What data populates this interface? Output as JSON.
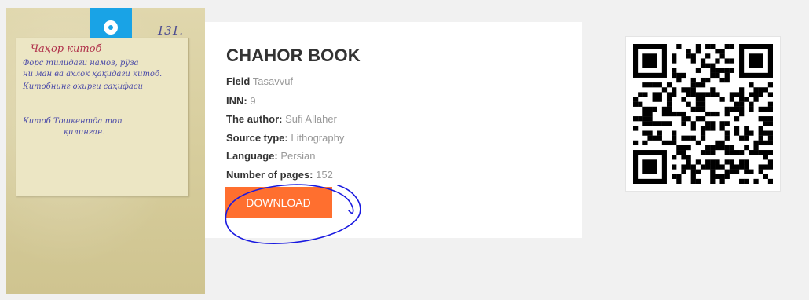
{
  "book": {
    "title": "CHAHOR BOOK",
    "fields": [
      {
        "label": "Field",
        "value": "Tasavvuf"
      },
      {
        "label": "INN:",
        "value": "9"
      },
      {
        "label": "The author:",
        "value": "Sufi Allaher"
      },
      {
        "label": "Source type:",
        "value": "Lithography"
      },
      {
        "label": "Language:",
        "value": "Persian"
      },
      {
        "label": "Number of pages:",
        "value": "152"
      }
    ],
    "download_label": "DOWNLOAD"
  },
  "cover": {
    "badge_icon": "disc-icon",
    "number": "131.",
    "handwriting": [
      "Чаҳор китоб",
      "Форс тилидаги намоз, рўза",
      "ни ман ва ахлок ҳақидаги китоб.",
      "Китобнинг охирги саҳифаси ",
      "Китоб Тошкентда топ",
      "қилинган."
    ]
  },
  "colors": {
    "accent": "#ff6f2f",
    "badge": "#19a3e6",
    "annotation": "#1a1ae0"
  }
}
